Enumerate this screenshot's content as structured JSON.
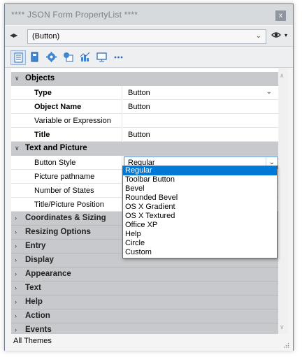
{
  "window": {
    "title": "**** JSON Form PropertyList ****",
    "close_glyph": "x"
  },
  "selector": {
    "value": "(Button)",
    "nav_glyph": "◀▶",
    "chevron": "⌄",
    "eye_caret": "▾"
  },
  "toolbar": {
    "buttons": [
      {
        "name": "list-icon",
        "active": true
      },
      {
        "name": "object-icon",
        "active": false
      },
      {
        "name": "gear-icon",
        "active": false
      },
      {
        "name": "shapes-icon",
        "active": false
      },
      {
        "name": "chart-icon",
        "active": false
      },
      {
        "name": "display-icon",
        "active": false
      },
      {
        "name": "more-icon",
        "active": false
      }
    ]
  },
  "groups": {
    "objects": "Objects",
    "text_and_picture": "Text and Picture",
    "coordinates": "Coordinates & Sizing",
    "resizing": "Resizing Options",
    "entry": "Entry",
    "display": "Display",
    "appearance": "Appearance",
    "text": "Text",
    "help": "Help",
    "action": "Action",
    "events": "Events"
  },
  "properties": {
    "type": {
      "name": "Type",
      "value": "Button"
    },
    "object_name": {
      "name": "Object Name",
      "value": "Button"
    },
    "variable": {
      "name": "Variable or Expression",
      "value": ""
    },
    "title": {
      "name": "Title",
      "value": "Button"
    },
    "button_style": {
      "name": "Button Style",
      "value": "Regular"
    },
    "picture_pathname": {
      "name": "Picture pathname",
      "value": ""
    },
    "number_of_states": {
      "name": "Number of States",
      "value": ""
    },
    "title_picture_position": {
      "name": "Title/Picture Position",
      "value": ""
    }
  },
  "dropdown": {
    "options": [
      "Regular",
      "Toolbar Button",
      "Bevel",
      "Rounded Bevel",
      "OS X Gradient",
      "OS X Textured",
      "Office XP",
      "Help",
      "Circle",
      "Custom"
    ],
    "selected_index": 0
  },
  "status": {
    "text": "All Themes"
  },
  "glyphs": {
    "open_arrow": "∨",
    "closed_arrow": "›",
    "dd": "⌄",
    "scroll_up": "∧",
    "scroll_down": "∨"
  },
  "colors": {
    "accent": "#0078d7",
    "group_bg": "#c7c9cc"
  }
}
